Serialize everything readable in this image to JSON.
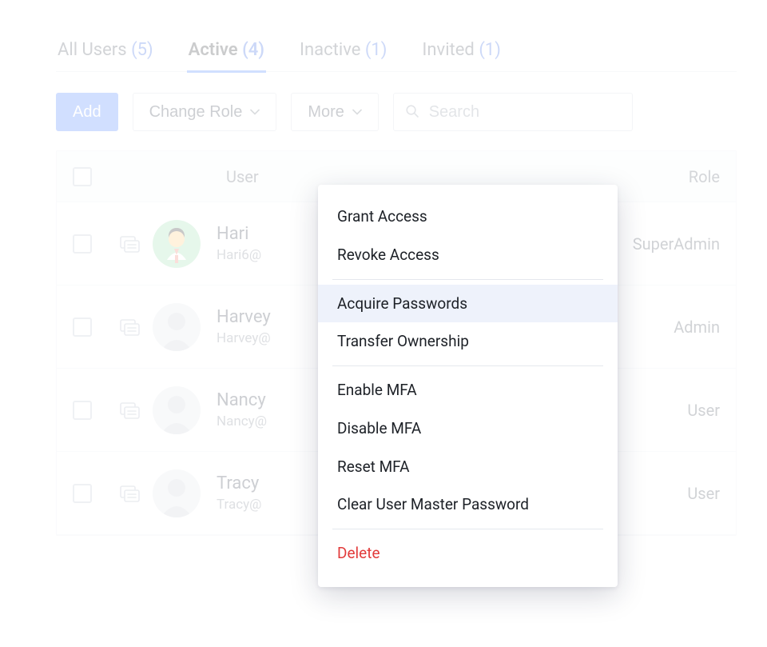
{
  "tabs": [
    {
      "label": "All Users",
      "count": "(5)",
      "active": false
    },
    {
      "label": "Active",
      "count": "(4)",
      "active": true
    },
    {
      "label": "Inactive",
      "count": "(1)",
      "active": false
    },
    {
      "label": "Invited",
      "count": "(1)",
      "active": false
    }
  ],
  "toolbar": {
    "add_label": "Add",
    "change_role_label": "Change Role",
    "more_label": "More",
    "search_placeholder": "Search"
  },
  "columns": {
    "user": "User",
    "role": "Role"
  },
  "rows": [
    {
      "name": "Hari",
      "email": "Hari6@",
      "role": "SuperAdmin",
      "avatar": "green"
    },
    {
      "name": "Harvey",
      "email": "Harvey@",
      "role": "Admin",
      "avatar": "generic"
    },
    {
      "name": "Nancy",
      "email": "Nancy@",
      "role": "User",
      "avatar": "generic"
    },
    {
      "name": "Tracy",
      "email": "Tracy@",
      "role": "User",
      "avatar": "generic"
    }
  ],
  "dropdown": {
    "groups": [
      [
        "Grant Access",
        "Revoke Access"
      ],
      [
        "Acquire Passwords",
        "Transfer Ownership"
      ],
      [
        "Enable MFA",
        "Disable MFA",
        "Reset MFA",
        "Clear User Master Password"
      ],
      [
        "Delete"
      ]
    ],
    "highlight": "Acquire Passwords",
    "danger": "Delete"
  }
}
